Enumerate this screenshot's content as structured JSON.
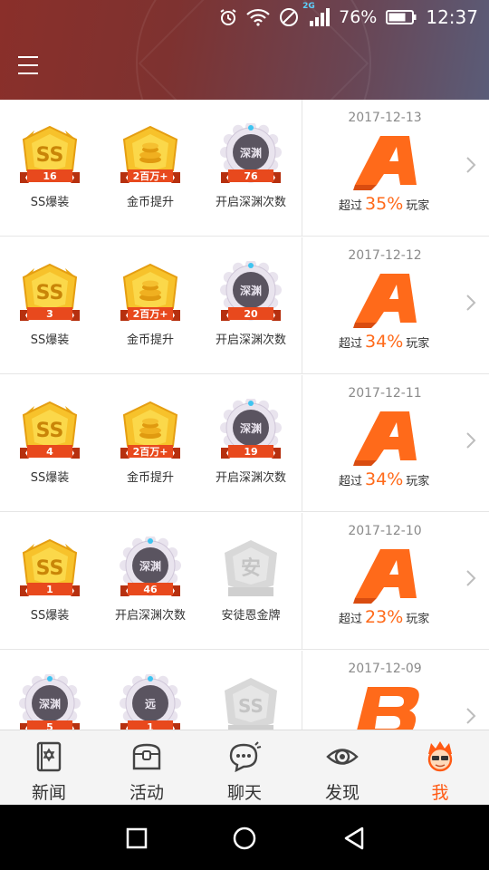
{
  "statusbar": {
    "network": "2G",
    "battery": "76%",
    "time": "12:37"
  },
  "colors": {
    "accent": "#ff6a1a",
    "gold": "#f7c22b",
    "ribbon": "#e8491d",
    "abyss": "#5a5460",
    "locked": "#d8d8d8"
  },
  "records": [
    {
      "date": "2017-12-13",
      "grade": "A",
      "beat_prefix": "超过",
      "percent": "35%",
      "beat_suffix": "玩家",
      "badges": [
        {
          "type": "ss",
          "count": "16",
          "label": "SS爆装",
          "icon": "ss-gold-icon"
        },
        {
          "type": "coin",
          "count": "2百万+",
          "label": "金币提升",
          "icon": "coin-gold-icon"
        },
        {
          "type": "abyss",
          "count": "76",
          "label": "开启深渊次数",
          "icon": "abyss-gear-icon",
          "mark": "深渊"
        }
      ]
    },
    {
      "date": "2017-12-12",
      "grade": "A",
      "beat_prefix": "超过",
      "percent": "34%",
      "beat_suffix": "玩家",
      "badges": [
        {
          "type": "ss",
          "count": "3",
          "label": "SS爆装",
          "icon": "ss-gold-icon"
        },
        {
          "type": "coin",
          "count": "2百万+",
          "label": "金币提升",
          "icon": "coin-gold-icon"
        },
        {
          "type": "abyss",
          "count": "20",
          "label": "开启深渊次数",
          "icon": "abyss-gear-icon",
          "mark": "深渊"
        }
      ]
    },
    {
      "date": "2017-12-11",
      "grade": "A",
      "beat_prefix": "超过",
      "percent": "34%",
      "beat_suffix": "玩家",
      "badges": [
        {
          "type": "ss",
          "count": "4",
          "label": "SS爆装",
          "icon": "ss-gold-icon"
        },
        {
          "type": "coin",
          "count": "2百万+",
          "label": "金币提升",
          "icon": "coin-gold-icon"
        },
        {
          "type": "abyss",
          "count": "19",
          "label": "开启深渊次数",
          "icon": "abyss-gear-icon",
          "mark": "深渊"
        }
      ]
    },
    {
      "date": "2017-12-10",
      "grade": "A",
      "beat_prefix": "超过",
      "percent": "23%",
      "beat_suffix": "玩家",
      "badges": [
        {
          "type": "ss",
          "count": "1",
          "label": "SS爆装",
          "icon": "ss-gold-icon"
        },
        {
          "type": "abyss",
          "count": "46",
          "label": "开启深渊次数",
          "icon": "abyss-gear-icon",
          "mark": "深渊"
        },
        {
          "type": "locked",
          "count": "",
          "label": "安徒恩金牌",
          "icon": "anton-locked-icon",
          "mark": "安"
        }
      ]
    },
    {
      "date": "2017-12-09",
      "grade": "B",
      "beat_prefix": "",
      "percent": "",
      "beat_suffix": "",
      "badges": [
        {
          "type": "abyss",
          "count": "5",
          "label": "",
          "icon": "abyss-gear-icon",
          "mark": "深渊"
        },
        {
          "type": "abyss",
          "count": "1",
          "label": "",
          "icon": "yuan-gear-icon",
          "mark": "远"
        },
        {
          "type": "lockedss",
          "count": "",
          "label": "",
          "icon": "ss-locked-icon",
          "mark": ""
        }
      ]
    }
  ],
  "nav": [
    {
      "label": "新闻",
      "icon": "news-book-icon"
    },
    {
      "label": "活动",
      "icon": "activity-chest-icon"
    },
    {
      "label": "聊天",
      "icon": "chat-bubble-icon"
    },
    {
      "label": "发现",
      "icon": "discover-eye-icon"
    },
    {
      "label": "我",
      "icon": "me-avatar-icon",
      "active": true
    }
  ]
}
